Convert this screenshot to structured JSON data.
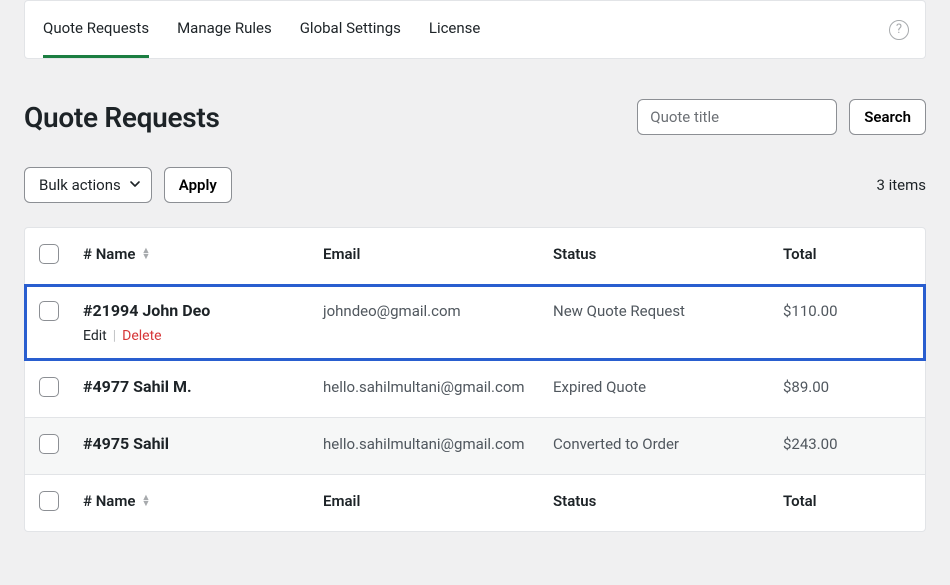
{
  "tabs": {
    "items": [
      {
        "label": "Quote Requests",
        "active": true
      },
      {
        "label": "Manage Rules",
        "active": false
      },
      {
        "label": "Global Settings",
        "active": false
      },
      {
        "label": "License",
        "active": false
      }
    ]
  },
  "help_icon_label": "?",
  "page_title": "Quote Requests",
  "search": {
    "placeholder": "Quote title",
    "button_label": "Search"
  },
  "bulk": {
    "select_label": "Bulk actions",
    "apply_label": "Apply"
  },
  "items_count_text": "3 items",
  "columns": {
    "name": "# Name",
    "email": "Email",
    "status": "Status",
    "total": "Total"
  },
  "row_actions": {
    "edit": "Edit",
    "delete": "Delete"
  },
  "rows": [
    {
      "name": "#21994 John Deo",
      "email": "johndeo@gmail.com",
      "status": "New Quote Request",
      "total": "$110.00",
      "show_actions": true,
      "highlight": true,
      "alt": false
    },
    {
      "name": "#4977 Sahil M.",
      "email": "hello.sahilmultani@gmail.com",
      "status": "Expired Quote",
      "total": "$89.00",
      "show_actions": false,
      "highlight": false,
      "alt": false
    },
    {
      "name": "#4975 Sahil",
      "email": "hello.sahilmultani@gmail.com",
      "status": "Converted to Order",
      "total": "$243.00",
      "show_actions": false,
      "highlight": false,
      "alt": true
    }
  ]
}
